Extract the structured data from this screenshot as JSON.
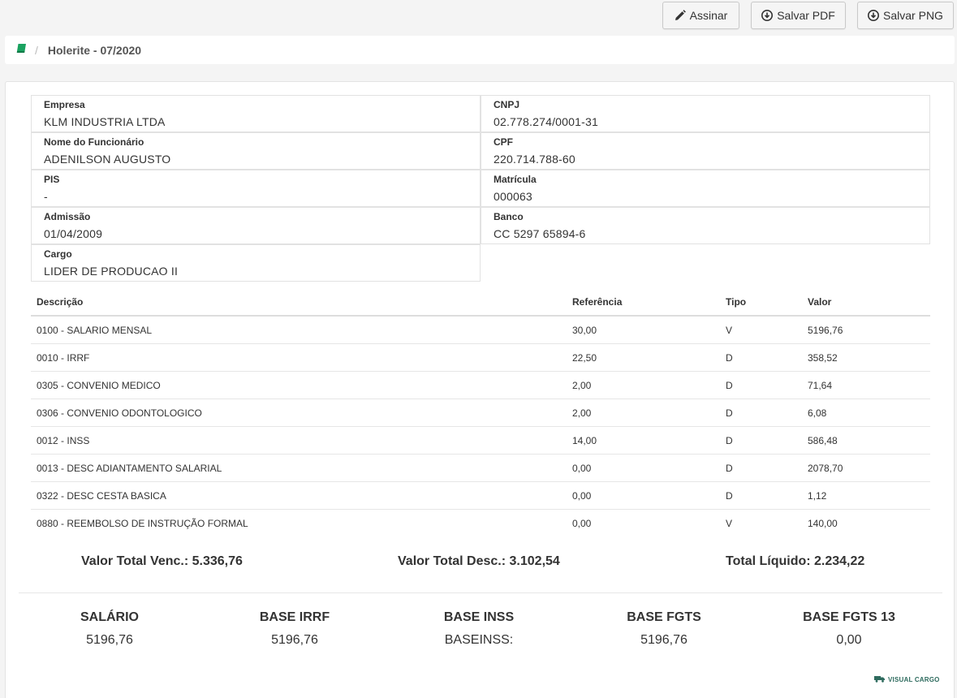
{
  "toolbar": {
    "assinar_label": "Assinar",
    "pdf_label": "Salvar PDF",
    "png_label": "Salvar PNG"
  },
  "breadcrumb": {
    "separator": "/",
    "title": "Holerite - 07/2020",
    "icon_color": "#1aa260"
  },
  "employee": {
    "empresa_label": "Empresa",
    "empresa": "KLM INDUSTRIA LTDA",
    "cnpj_label": "CNPJ",
    "cnpj": "02.778.274/0001-31",
    "nome_label": "Nome do Funcionário",
    "nome": "ADENILSON AUGUSTO",
    "cpf_label": "CPF",
    "cpf": "220.714.788-60",
    "pis_label": "PIS",
    "pis": "-",
    "matricula_label": "Matrícula",
    "matricula": "000063",
    "admissao_label": "Admissão",
    "admissao": "01/04/2009",
    "banco_label": "Banco",
    "banco": "CC 5297 65894-6",
    "cargo_label": "Cargo",
    "cargo": "LIDER DE PRODUCAO II"
  },
  "items": {
    "headers": {
      "descricao": "Descrição",
      "referencia": "Referência",
      "tipo": "Tipo",
      "valor": "Valor"
    },
    "rows": [
      {
        "descricao": "0100 - SALARIO MENSAL",
        "referencia": "30,00",
        "tipo": "V",
        "valor": "5196,76"
      },
      {
        "descricao": "0010 - IRRF",
        "referencia": "22,50",
        "tipo": "D",
        "valor": "358,52"
      },
      {
        "descricao": "0305 - CONVENIO MEDICO",
        "referencia": "2,00",
        "tipo": "D",
        "valor": "71,64"
      },
      {
        "descricao": "0306 - CONVENIO ODONTOLOGICO",
        "referencia": "2,00",
        "tipo": "D",
        "valor": "6,08"
      },
      {
        "descricao": "0012 - INSS",
        "referencia": "14,00",
        "tipo": "D",
        "valor": "586,48"
      },
      {
        "descricao": "0013 - DESC ADIANTAMENTO SALARIAL",
        "referencia": "0,00",
        "tipo": "D",
        "valor": "2078,70"
      },
      {
        "descricao": "0322 - DESC CESTA BASICA",
        "referencia": "0,00",
        "tipo": "D",
        "valor": "1,12"
      },
      {
        "descricao": "0880 - REEMBOLSO DE INSTRUÇÃO FORMAL",
        "referencia": "0,00",
        "tipo": "V",
        "valor": "140,00"
      }
    ]
  },
  "totals": {
    "vencimentos": "Valor Total Venc.: 5.336,76",
    "descontos": "Valor Total Desc.: 3.102,54",
    "liquido": "Total Líquido: 2.234,22"
  },
  "bases": [
    {
      "label": "SALÁRIO",
      "value": "5196,76"
    },
    {
      "label": "BASE IRRF",
      "value": "5196,76"
    },
    {
      "label": "BASE INSS",
      "value": "BASEINSS:"
    },
    {
      "label": "BASE FGTS",
      "value": "5196,76"
    },
    {
      "label": "BASE FGTS 13",
      "value": "0,00"
    }
  ],
  "logo": {
    "text": "VISUAL CARGO",
    "color": "#2e6b5e"
  }
}
